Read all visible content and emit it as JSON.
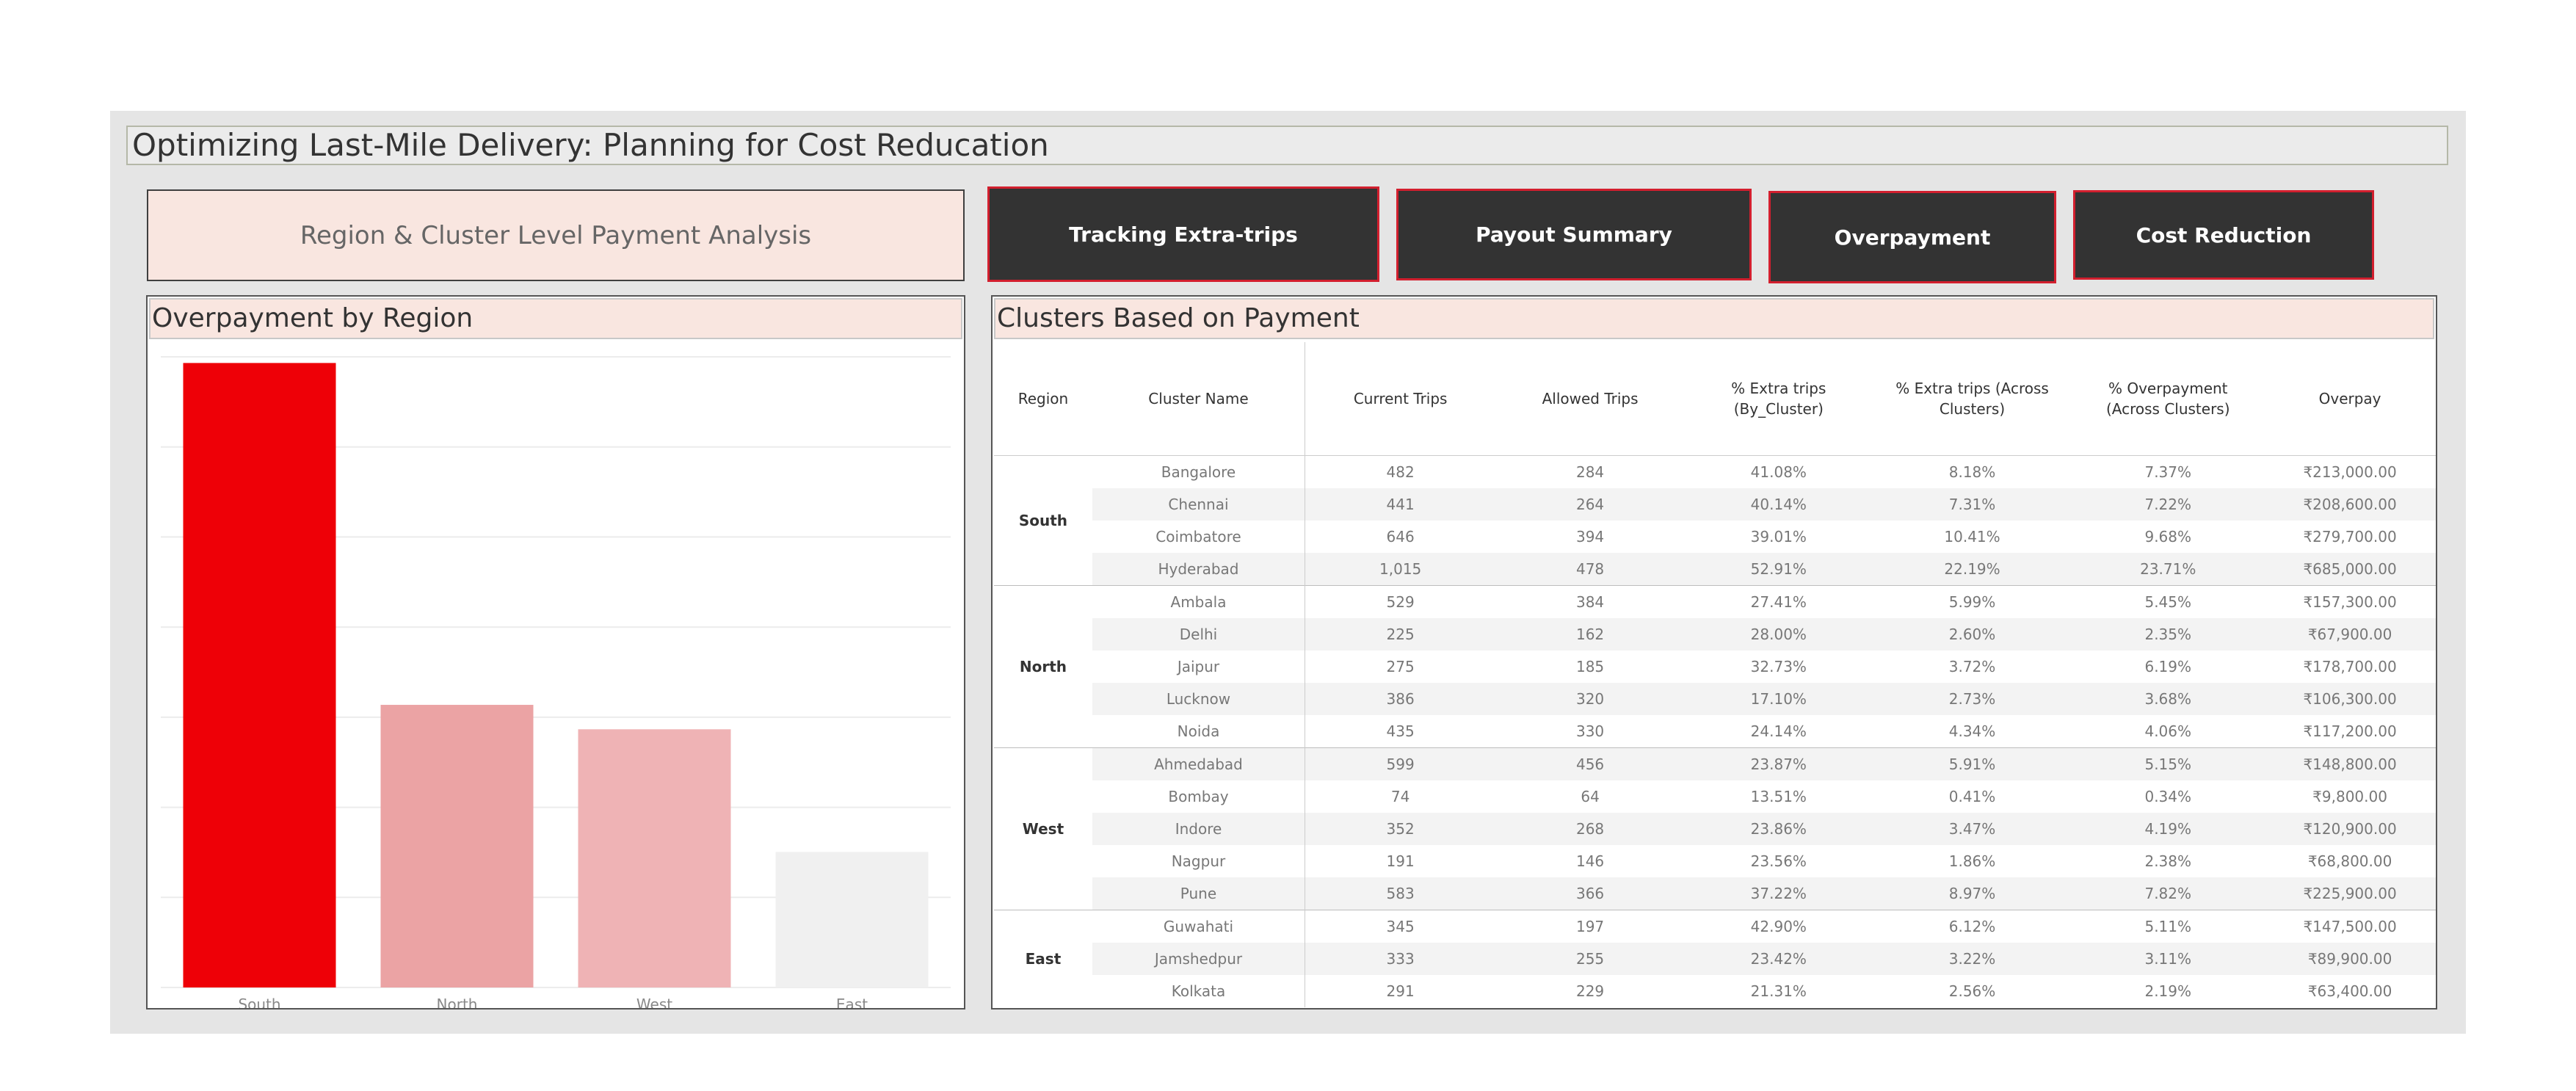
{
  "dashboard": {
    "title": "Optimizing Last-Mile Delivery: Planning for Cost Reducation",
    "subtitle": "Region & Cluster Level Payment Analysis",
    "nav": {
      "tracking": "Tracking Extra-trips",
      "payout": "Payout Summary",
      "overpayment": "Overpayment",
      "cost_reduction": "Cost Reduction"
    }
  },
  "chart_panel": {
    "title": "Overpayment by Region"
  },
  "chart_data": {
    "type": "bar",
    "categories": [
      "South",
      "North",
      "West",
      "East"
    ],
    "values": [
      1386300,
      627400,
      573200,
      300800
    ],
    "colors": [
      "#ee0007",
      "#eba3a4",
      "#efb3b5",
      "#f0f0f0"
    ],
    "ylim": [
      0,
      1400000
    ],
    "grid": true
  },
  "table_panel": {
    "title": "Clusters Based on Payment",
    "headers": {
      "region": "Region",
      "cluster": "Cluster Name",
      "current": "Current Trips",
      "allowed": "Allowed Trips",
      "extra_by_cluster": "% Extra trips (By_Cluster)",
      "extra_across": "% Extra trips (Across Clusters)",
      "overpay_across": "% Overpayment (Across Clusters)",
      "overpay": "Overpay"
    },
    "groups": [
      {
        "region": "South",
        "rows": [
          [
            "Bangalore",
            "482",
            "284",
            "41.08%",
            "8.18%",
            "7.37%",
            "₹213,000.00"
          ],
          [
            "Chennai",
            "441",
            "264",
            "40.14%",
            "7.31%",
            "7.22%",
            "₹208,600.00"
          ],
          [
            "Coimbatore",
            "646",
            "394",
            "39.01%",
            "10.41%",
            "9.68%",
            "₹279,700.00"
          ],
          [
            "Hyderabad",
            "1,015",
            "478",
            "52.91%",
            "22.19%",
            "23.71%",
            "₹685,000.00"
          ]
        ]
      },
      {
        "region": "North",
        "rows": [
          [
            "Ambala",
            "529",
            "384",
            "27.41%",
            "5.99%",
            "5.45%",
            "₹157,300.00"
          ],
          [
            "Delhi",
            "225",
            "162",
            "28.00%",
            "2.60%",
            "2.35%",
            "₹67,900.00"
          ],
          [
            "Jaipur",
            "275",
            "185",
            "32.73%",
            "3.72%",
            "6.19%",
            "₹178,700.00"
          ],
          [
            "Lucknow",
            "386",
            "320",
            "17.10%",
            "2.73%",
            "3.68%",
            "₹106,300.00"
          ],
          [
            "Noida",
            "435",
            "330",
            "24.14%",
            "4.34%",
            "4.06%",
            "₹117,200.00"
          ]
        ]
      },
      {
        "region": "West",
        "rows": [
          [
            "Ahmedabad",
            "599",
            "456",
            "23.87%",
            "5.91%",
            "5.15%",
            "₹148,800.00"
          ],
          [
            "Bombay",
            "74",
            "64",
            "13.51%",
            "0.41%",
            "0.34%",
            "₹9,800.00"
          ],
          [
            "Indore",
            "352",
            "268",
            "23.86%",
            "3.47%",
            "4.19%",
            "₹120,900.00"
          ],
          [
            "Nagpur",
            "191",
            "146",
            "23.56%",
            "1.86%",
            "2.38%",
            "₹68,800.00"
          ],
          [
            "Pune",
            "583",
            "366",
            "37.22%",
            "8.97%",
            "7.82%",
            "₹225,900.00"
          ]
        ]
      },
      {
        "region": "East",
        "rows": [
          [
            "Guwahati",
            "345",
            "197",
            "42.90%",
            "6.12%",
            "5.11%",
            "₹147,500.00"
          ],
          [
            "Jamshedpur",
            "333",
            "255",
            "23.42%",
            "3.22%",
            "3.11%",
            "₹89,900.00"
          ],
          [
            "Kolkata",
            "291",
            "229",
            "21.31%",
            "2.56%",
            "2.19%",
            "₹63,400.00"
          ]
        ]
      }
    ]
  }
}
